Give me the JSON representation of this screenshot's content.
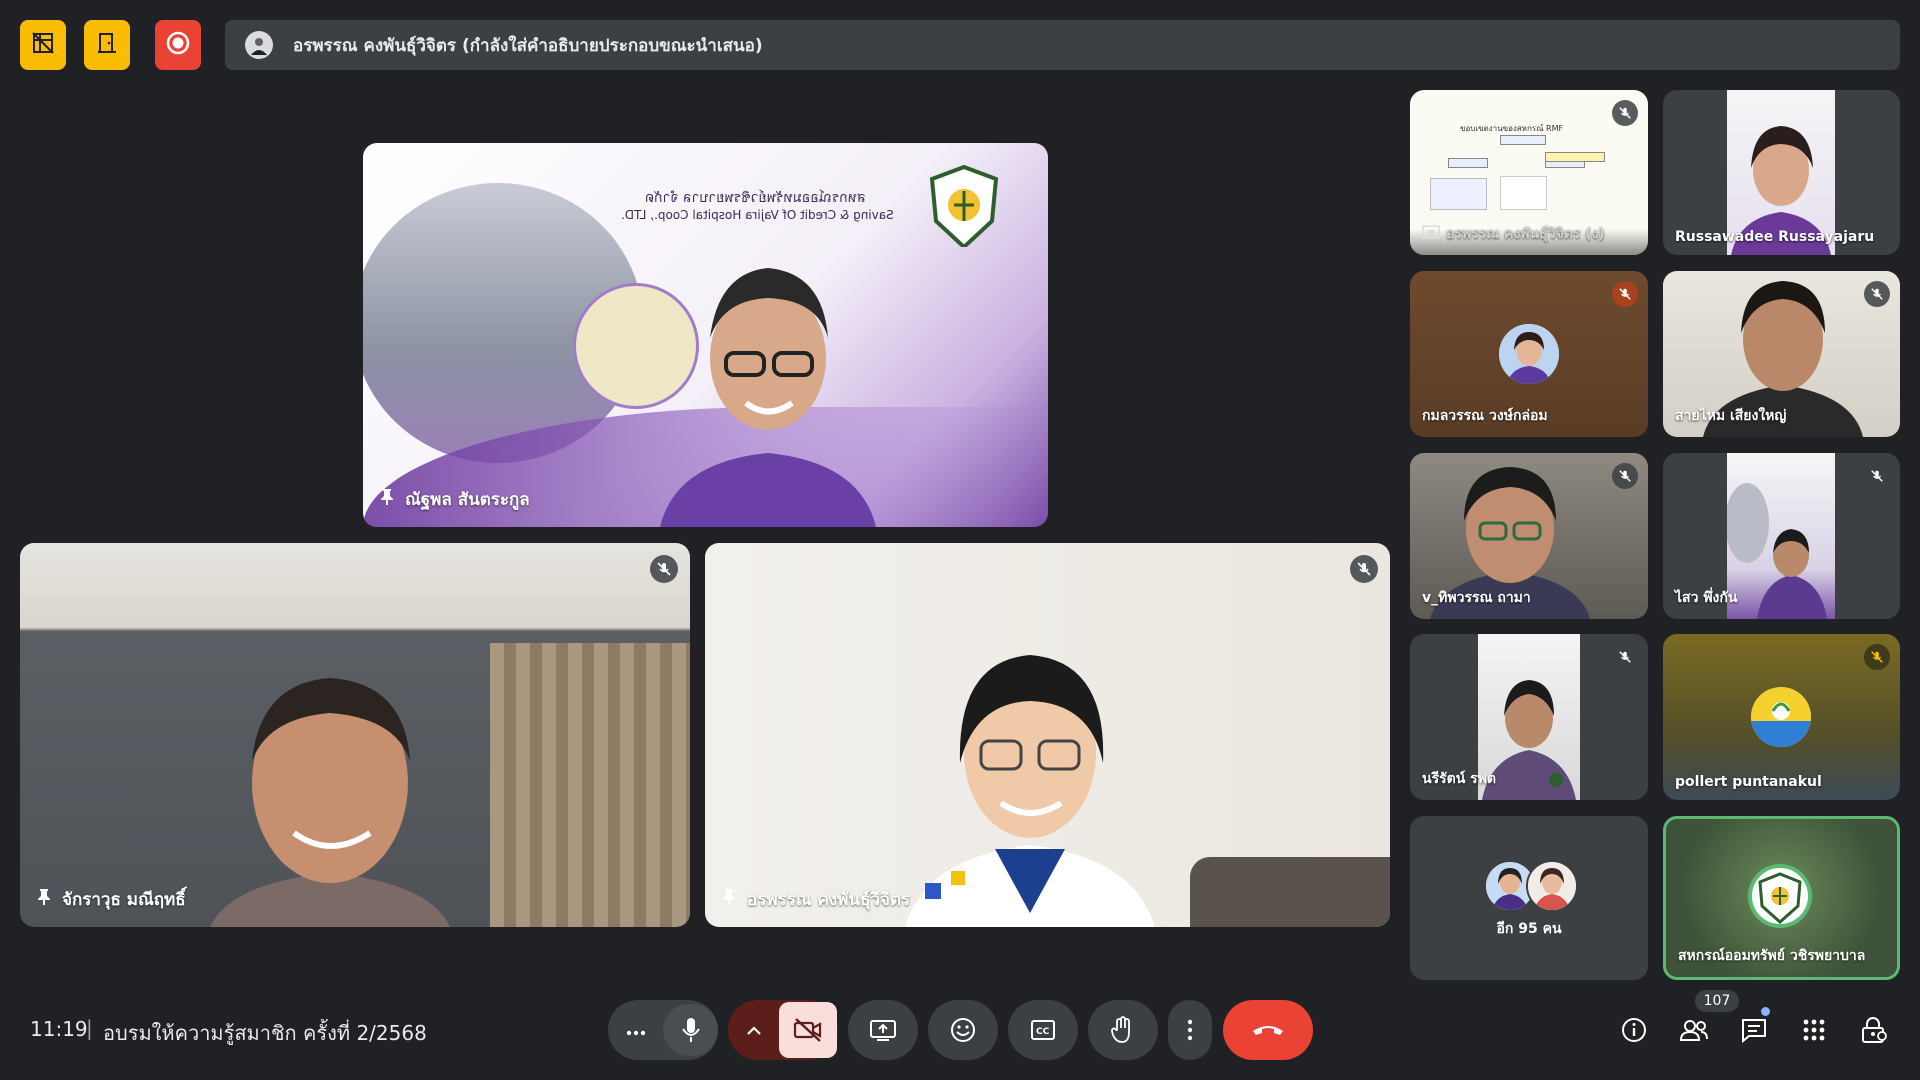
{
  "presenting_banner": "อรพรรณ คงพันธุ์วิจิตร (กำลังใส่คำอธิบายประกอบขณะนำเสนอ)",
  "main_tiles": [
    {
      "name": "ณัฐพล สันตระกูล",
      "slide_th": "สหกรณ์ออมทรัพย์วชิรพยาบาล จำกัด",
      "slide_en": "Saving & Credit Of Vajira Hospital Coop., LTD."
    },
    {
      "name": "จักราวุธ มณีฤทธิ์"
    },
    {
      "name": "อรพรรณ คงพันธุ์วิจิตร"
    }
  ],
  "sidebar_tiles": [
    {
      "name": "อรพรรณ คงพันธุ์วิจิตร (ง)",
      "slide_title": "ขอบเขตงานของสหกรณ์ RMF"
    },
    {
      "name": "Russawadee Russayajaru"
    },
    {
      "name": "กมลวรรณ วงษ์กล่อม"
    },
    {
      "name": "สายไหม เสียงใหญ่"
    },
    {
      "name": "v_ทิพวรรณ ถามา"
    },
    {
      "name": "ไสว พึ่งกัน"
    },
    {
      "name": "นรีรัตน์ รพต"
    },
    {
      "name": "pollert puntanakul"
    },
    {
      "name": "อีก 95 คน"
    },
    {
      "name": "สหกรณ์ออมทรัพย์ วชิรพยาบาล"
    }
  ],
  "meeting": {
    "time": "11:19",
    "separator": "|",
    "title": "อบรมให้ความรู้สมาชิก ครั้งที่ 2/2568"
  },
  "controls": {
    "more": "more-options",
    "participant_count": "107"
  },
  "colors": {
    "bg": "#202124",
    "tile": "#3c4043",
    "red": "#ea4335",
    "amber": "#fbbc04",
    "accent_green": "#5bb974"
  }
}
